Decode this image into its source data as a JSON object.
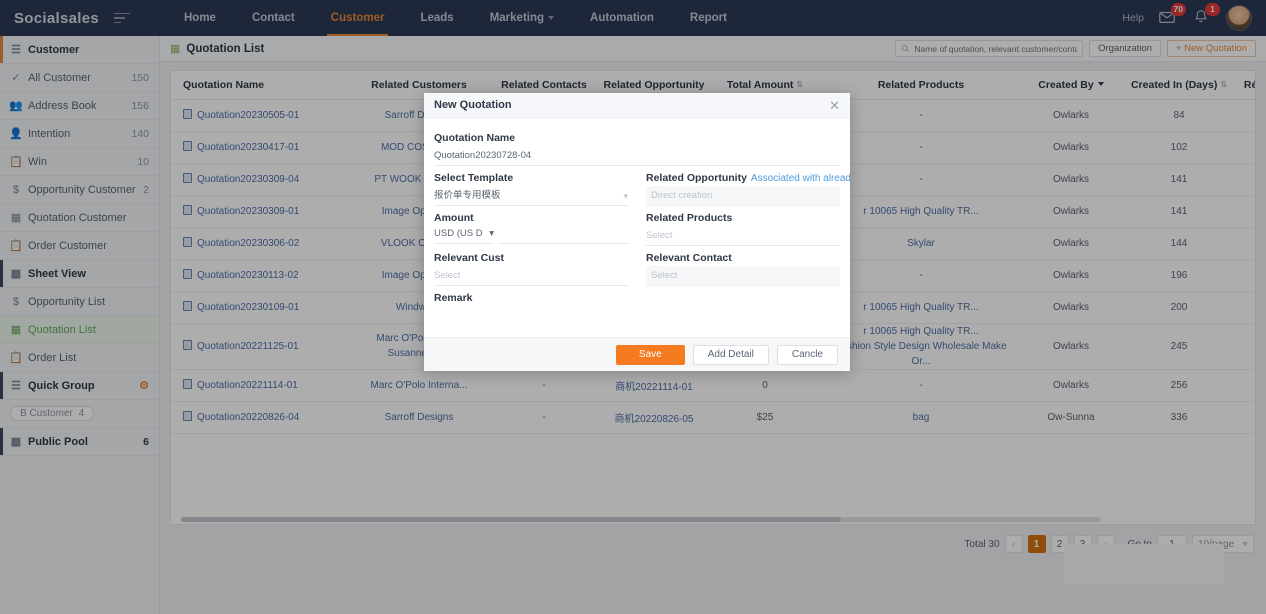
{
  "topnav": {
    "brand": "Socialsales",
    "menu_icon": "hamburger-icon",
    "items": [
      {
        "label": "Home",
        "active": false,
        "caret": false
      },
      {
        "label": "Contact",
        "active": false,
        "caret": false
      },
      {
        "label": "Customer",
        "active": true,
        "caret": false
      },
      {
        "label": "Leads",
        "active": false,
        "caret": false
      },
      {
        "label": "Marketing",
        "active": false,
        "caret": true
      },
      {
        "label": "Automation",
        "active": false,
        "caret": false
      },
      {
        "label": "Report",
        "active": false,
        "caret": false
      }
    ],
    "help": "Help",
    "message_badge": "70",
    "bell_badge": "1"
  },
  "sidebar": {
    "header": {
      "label": "Customer",
      "icon": "filter-icon"
    },
    "items": [
      {
        "label": "All Customer",
        "count": "150",
        "icon": "check-icon"
      },
      {
        "label": "Address Book",
        "count": "156",
        "icon": "contacts-icon"
      },
      {
        "label": "Intention",
        "count": "140",
        "icon": "person-icon"
      },
      {
        "label": "Win",
        "count": "10",
        "icon": "list-icon"
      },
      {
        "label": "Opportunity Customer",
        "count": "2",
        "icon": "dollar-icon"
      },
      {
        "label": "Quotation Customer",
        "count": "",
        "icon": "sheet-icon"
      },
      {
        "label": "Order Customer",
        "count": "",
        "icon": "list-icon"
      }
    ],
    "sheet_view": {
      "label": "Sheet View",
      "icon": "sheet-icon"
    },
    "sheet_items": [
      {
        "label": "Opportunity List",
        "count": "",
        "icon": "dollar-icon",
        "selected": false
      },
      {
        "label": "Quotation List",
        "count": "",
        "icon": "sheet-icon",
        "selected": true
      },
      {
        "label": "Order List",
        "count": "",
        "icon": "list-icon",
        "selected": false
      }
    ],
    "quick_group": {
      "label": "Quick Group",
      "icon": "filter-icon",
      "gear": "gear-icon"
    },
    "quick_group_tag": {
      "label": "B Customer",
      "count": "4"
    },
    "public_pool": {
      "label": "Public Pool",
      "count": "6",
      "icon": "pool-icon"
    }
  },
  "page": {
    "title": "Quotation List",
    "title_icon": "sheet-icon",
    "search_placeholder": "Name of quotation, relevant customer/contact/b",
    "search_value": "",
    "search_icon": "search-icon",
    "organization_button": "Organization",
    "new_quotation_button": "+ New Quotation"
  },
  "table": {
    "columns": [
      {
        "label": "Quotation Name",
        "sort": false,
        "align": "left"
      },
      {
        "label": "Related Customers",
        "sort": false,
        "align": "center"
      },
      {
        "label": "Related Contacts",
        "sort": false,
        "align": "center"
      },
      {
        "label": "Related Opportunity",
        "sort": false,
        "align": "center"
      },
      {
        "label": "Total Amount",
        "sort": true,
        "align": "center"
      },
      {
        "label": "Related Products",
        "sort": false,
        "align": "center"
      },
      {
        "label": "Created By",
        "caret": true,
        "align": "center"
      },
      {
        "label": "Created In (Days)",
        "sort": true,
        "align": "center"
      },
      {
        "label": "Ré",
        "align": "center"
      }
    ],
    "settings_icon": "column-settings-icon",
    "rows": [
      {
        "name": "Quotation20230505-01",
        "customer": "Sarroff Designs",
        "contact": "",
        "opportunity": "",
        "amount": "",
        "products": "-",
        "created_by": "Owlarks",
        "days": "84",
        "re": ""
      },
      {
        "name": "Quotation20230417-01",
        "customer": "MOD COSMET...",
        "contact": "",
        "opportunity": "",
        "amount": "",
        "products": "-",
        "created_by": "Owlarks",
        "days": "102",
        "re": ""
      },
      {
        "name": "Quotation20230309-04",
        "customer": "PT WOOK MOBIL...",
        "contact": "",
        "opportunity": "",
        "amount": "",
        "products": "-",
        "created_by": "Owlarks",
        "days": "141",
        "re": ""
      },
      {
        "name": "Quotation20230309-01",
        "customer": "Image Optome...",
        "contact": "",
        "opportunity": "",
        "amount": "",
        "products": "r 10065 High Quality TR...",
        "created_by": "Owlarks",
        "days": "141",
        "re": ""
      },
      {
        "name": "Quotation20230306-02",
        "customer": "VLOOK OPTIC...",
        "contact": "",
        "opportunity": "",
        "amount": "",
        "products": "Skylar",
        "created_by": "Owlarks",
        "days": "144",
        "re": ""
      },
      {
        "name": "Quotation20230113-02",
        "customer": "Image Optome...",
        "contact": "",
        "opportunity": "",
        "amount": "",
        "products": "-",
        "created_by": "Owlarks",
        "days": "196",
        "re": ""
      },
      {
        "name": "Quotation20230109-01",
        "customer": "Windwave",
        "contact": "",
        "opportunity": "",
        "amount": "",
        "products": "r 10065 High Quality TR...",
        "created_by": "Owlarks",
        "days": "200",
        "re": ""
      },
      {
        "name": "Quotation20221125-01",
        "customer": "Marc O'Polo Inter...",
        "contact": "Susanne Hein",
        "opportunity": "",
        "amount": "",
        "products": "r 10065 High Quality TR...",
        "products2": "Fashion Style Design Wholesale Make Or...",
        "created_by": "Owlarks",
        "days": "245",
        "re": ""
      },
      {
        "name": "Quotation20221114-01",
        "customer": "Marc O'Polo Interna...",
        "contact": "-",
        "opportunity": "商机20221114-01",
        "amount": "0",
        "products": "-",
        "created_by": "Owlarks",
        "days": "256",
        "re": ""
      },
      {
        "name": "Quotation20220826-04",
        "customer": "Sarroff Designs",
        "contact": "-",
        "opportunity": "商机20220826-05",
        "amount": "$25",
        "products": "bag",
        "created_by": "Ow-Sunna",
        "days": "336",
        "re": ""
      }
    ]
  },
  "pagination": {
    "total_label": "Total 30",
    "prev": "‹",
    "pages": [
      "1",
      "2",
      "3"
    ],
    "active_page": "1",
    "next": "›",
    "goto_label": "Go to",
    "goto_value": "1",
    "per_page": "10/page"
  },
  "modal": {
    "title": "New Quotation",
    "close_icon": "close-icon",
    "quotation_name_label": "Quotation Name",
    "quotation_name_value": "Quotation20230728-04",
    "select_template_label": "Select Template",
    "select_template_value": "报价单专用模板",
    "related_opportunity_label": "Related Opportunity",
    "related_opportunity_link": "Associated with already",
    "related_opportunity_placeholder": "Direct creation",
    "amount_label": "Amount",
    "amount_currency": "USD (US D",
    "amount_value": "",
    "related_products_label": "Related Products",
    "related_products_placeholder": "Select",
    "relevant_customer_label": "Relevant Cust",
    "relevant_customer_placeholder": "Select",
    "relevant_contact_label": "Relevant Contact",
    "relevant_contact_placeholder": "Select",
    "remark_label": "Remark",
    "remark_value": "",
    "save_button": "Save",
    "add_detail_button": "Add Detail",
    "cancel_button": "Cancle"
  },
  "colors": {
    "accent": "#e8893c",
    "primary_button": "#f47b20",
    "nav_bg": "#2b3a55",
    "link": "#4c6fa8",
    "selected_green": "#67a85b"
  }
}
